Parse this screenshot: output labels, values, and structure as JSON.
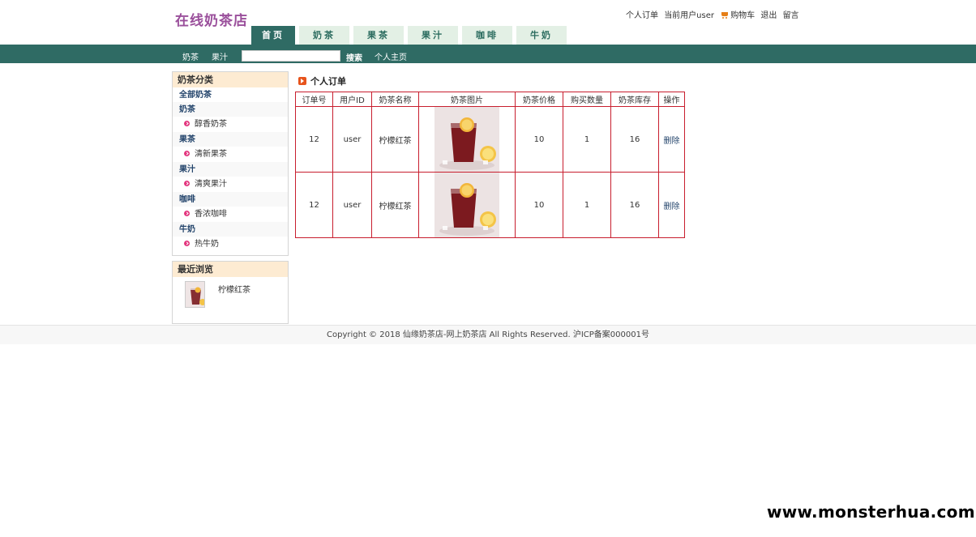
{
  "site": {
    "logo": "在线奶茶店"
  },
  "top_links": {
    "orders": "个人订单",
    "current_user": "当前用户user",
    "cart": "购物车",
    "logout": "退出",
    "message": "留言"
  },
  "nav_tabs": [
    {
      "label": "首页",
      "active": true
    },
    {
      "label": "奶茶"
    },
    {
      "label": "果茶"
    },
    {
      "label": "果汁"
    },
    {
      "label": "咖啡"
    },
    {
      "label": "牛奶"
    }
  ],
  "sub_nav": {
    "links": [
      "奶茶",
      "果汁"
    ],
    "search_value": "",
    "search_button": "搜索",
    "home_link": "个人主页"
  },
  "sidebar": {
    "categories_title": "奶茶分类",
    "all": "全部奶茶",
    "groups": [
      {
        "name": "奶茶",
        "item": "醇香奶茶"
      },
      {
        "name": "果茶",
        "item": "清新果茶"
      },
      {
        "name": "果汁",
        "item": "清爽果汁"
      },
      {
        "name": "咖啡",
        "item": "香浓咖啡"
      },
      {
        "name": "牛奶",
        "item": "热牛奶"
      }
    ],
    "recent_title": "最近浏览",
    "recent_item": "柠檬红茶"
  },
  "main": {
    "title": "个人订单",
    "headers": [
      "订单号",
      "用户ID",
      "奶茶名称",
      "奶茶图片",
      "奶茶价格",
      "购买数量",
      "奶茶库存",
      "操作"
    ],
    "rows": [
      {
        "order_id": "12",
        "user_id": "user",
        "name": "柠檬红茶",
        "price": "10",
        "quantity": "1",
        "stock": "16",
        "action": "删除"
      },
      {
        "order_id": "12",
        "user_id": "user",
        "name": "柠檬红茶",
        "price": "10",
        "quantity": "1",
        "stock": "16",
        "action": "删除"
      }
    ]
  },
  "footer": {
    "copyright": "Copyright © 2018 仙缘奶茶店-网上奶茶店 All Rights Reserved. 沪ICP备案000001号"
  },
  "watermark": "www.monsterhua.com",
  "colors": {
    "nav_bar": "#2f6b64",
    "logo": "#9a4f9b",
    "table_border": "#c81e2e",
    "tab_bg": "#e3f0e5",
    "side_header": "#fdebd2"
  }
}
